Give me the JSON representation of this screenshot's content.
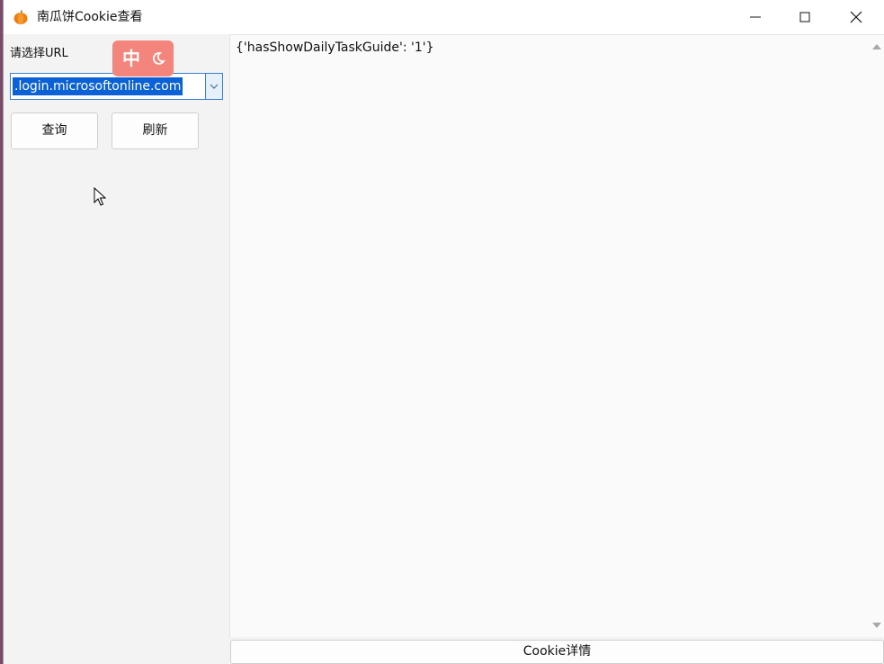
{
  "window": {
    "title": "南瓜饼Cookie查看"
  },
  "left": {
    "url_label": "请选择URL",
    "ime_indicator": "中",
    "url_combo_value": ".login.microsoftonline.com",
    "query_button": "查询",
    "refresh_button": "刷新"
  },
  "result": {
    "text": "{'hasShowDailyTaskGuide': '1'}"
  },
  "footer": {
    "details_button": "Cookie详情"
  },
  "icons": {
    "app": "pumpkin-icon",
    "minimize": "minimize-icon",
    "maximize": "maximize-icon",
    "close": "close-icon",
    "dropdown": "chevron-down-icon",
    "moon": "moon-icon",
    "scroll_up": "triangle-up-icon",
    "scroll_down": "triangle-down-icon",
    "cursor": "mouse-pointer-icon"
  },
  "colors": {
    "selection": "#0b62d6",
    "ime_badge": "#f4857c",
    "focus_border": "#3c7fd1"
  }
}
